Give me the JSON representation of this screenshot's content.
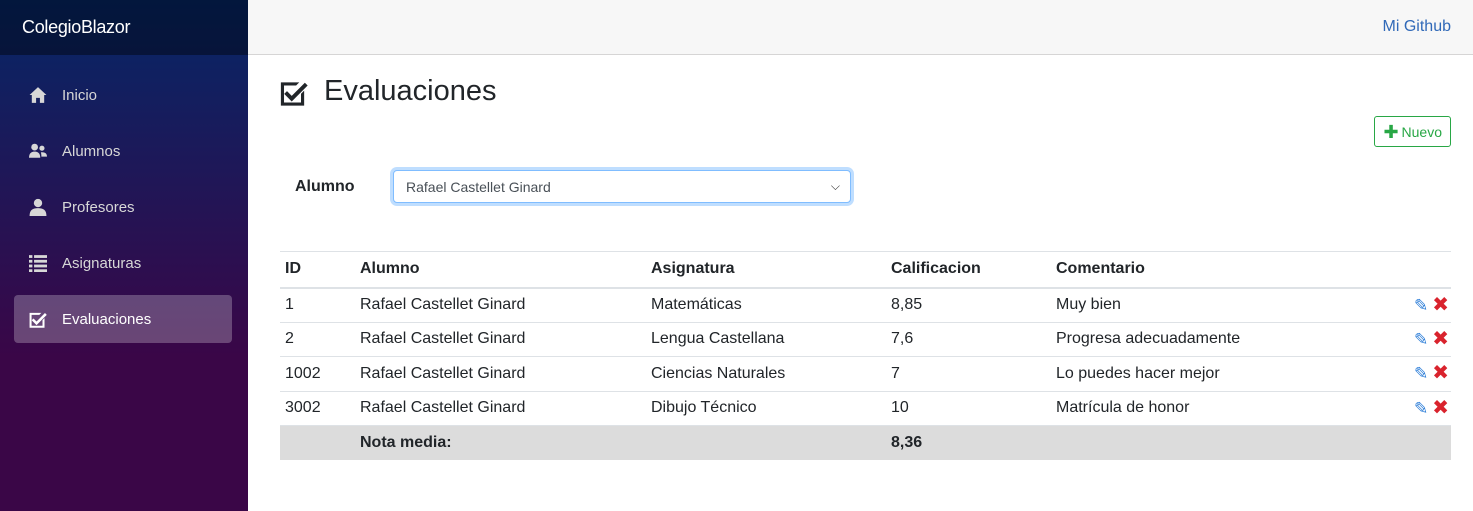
{
  "app": {
    "brand": "ColegioBlazor"
  },
  "topbar": {
    "github_link": "Mi Github"
  },
  "sidebar": {
    "items": [
      {
        "label": "Inicio",
        "icon": "home-icon",
        "active": false
      },
      {
        "label": "Alumnos",
        "icon": "people-icon",
        "active": false
      },
      {
        "label": "Profesores",
        "icon": "person-icon",
        "active": false
      },
      {
        "label": "Asignaturas",
        "icon": "list-icon",
        "active": false
      },
      {
        "label": "Evaluaciones",
        "icon": "checkbox-icon",
        "active": true
      }
    ]
  },
  "page": {
    "title": "Evaluaciones",
    "new_button": "Nuevo",
    "filter_label": "Alumno",
    "filter_value": "Rafael Castellet Ginard"
  },
  "table": {
    "headers": [
      "ID",
      "Alumno",
      "Asignatura",
      "Calificacion",
      "Comentario"
    ],
    "rows": [
      {
        "id": "1",
        "alumno": "Rafael Castellet Ginard",
        "asignatura": "Matemáticas",
        "calificacion": "8,85",
        "comentario": "Muy bien"
      },
      {
        "id": "2",
        "alumno": "Rafael Castellet Ginard",
        "asignatura": "Lengua Castellana",
        "calificacion": "7,6",
        "comentario": "Progresa adecuadamente"
      },
      {
        "id": "1002",
        "alumno": "Rafael Castellet Ginard",
        "asignatura": "Ciencias Naturales",
        "calificacion": "7",
        "comentario": "Lo puedes hacer mejor"
      },
      {
        "id": "3002",
        "alumno": "Rafael Castellet Ginard",
        "asignatura": "Dibujo Técnico",
        "calificacion": "10",
        "comentario": "Matrícula de honor"
      }
    ],
    "summary_label": "Nota media:",
    "summary_value": "8,36"
  },
  "colors": {
    "accent": "#28a745",
    "link": "#3069b8",
    "edit": "#2d7ed8",
    "delete": "#d9232d"
  }
}
